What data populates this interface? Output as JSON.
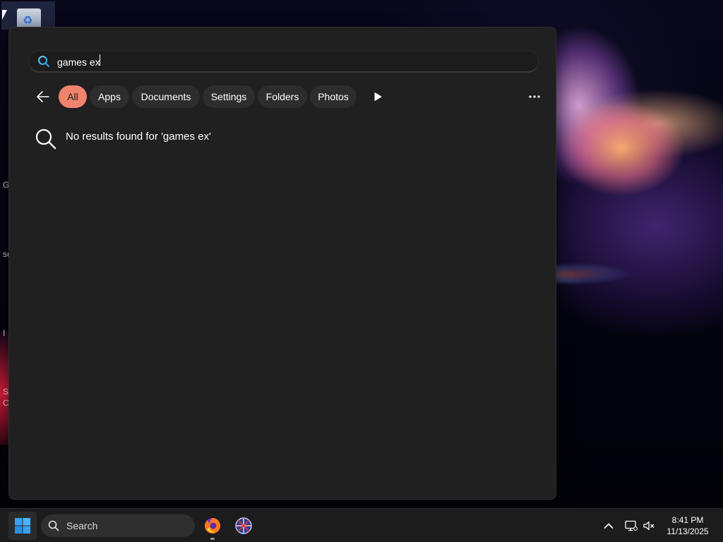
{
  "search_panel": {
    "query": "games ex",
    "filters": [
      {
        "label": "All",
        "active": true
      },
      {
        "label": "Apps",
        "active": false
      },
      {
        "label": "Documents",
        "active": false
      },
      {
        "label": "Settings",
        "active": false
      },
      {
        "label": "Folders",
        "active": false
      },
      {
        "label": "Photos",
        "active": false
      }
    ],
    "icons": {
      "search": "search-icon",
      "back": "back-arrow-icon",
      "more_filters": "play-icon",
      "more": "more-options-icon"
    },
    "no_results_message": "No results found for 'games ex'",
    "accent_color": "#f0836e"
  },
  "desktop": {
    "edge_labels": [
      "G",
      "se",
      "I",
      "S",
      "C"
    ]
  },
  "taskbar": {
    "search_label": "Search",
    "apps": [
      {
        "name": "Firefox",
        "icon": "firefox-icon"
      },
      {
        "name": "Language settings",
        "icon": "globe-icon"
      }
    ],
    "tray": {
      "chevron": "chevron-up-icon",
      "network": "network-icon",
      "volume": "volume-muted-icon"
    },
    "clock": {
      "time": "8:41 PM",
      "date": "11/13/2025"
    }
  }
}
